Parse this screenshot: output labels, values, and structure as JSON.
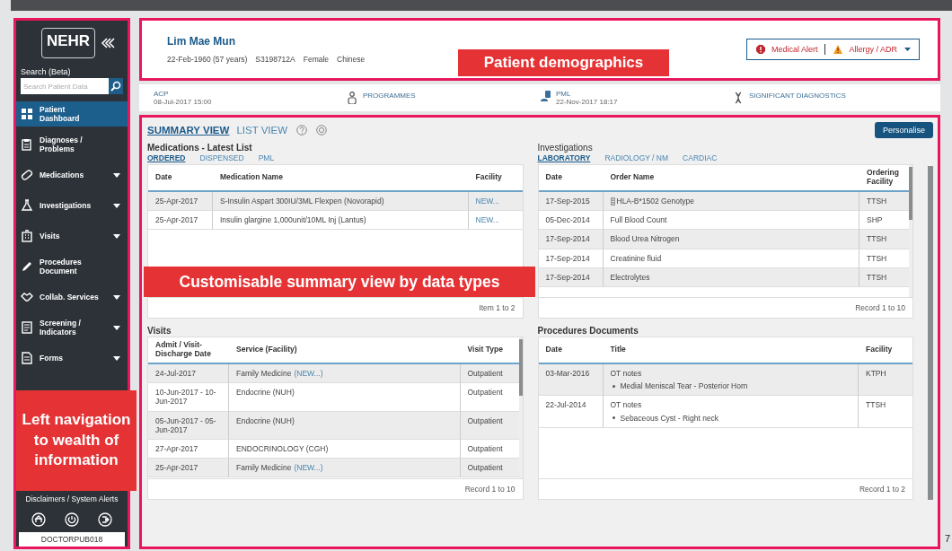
{
  "sidebar": {
    "logo": "NEHR",
    "search_label": "Search (Beta)",
    "search": {
      "placeholder": "Search Patient Data"
    },
    "items": [
      {
        "label": "Patient Dashboard",
        "selected": true,
        "expandable": false
      },
      {
        "label": "Diagnoses / Problems",
        "selected": false,
        "expandable": false
      },
      {
        "label": "Medications",
        "selected": false,
        "expandable": true
      },
      {
        "label": "Investigations",
        "selected": false,
        "expandable": true
      },
      {
        "label": "Visits",
        "selected": false,
        "expandable": true
      },
      {
        "label": "Procedures Document",
        "selected": false,
        "expandable": false
      },
      {
        "label": "Collab. Services",
        "selected": false,
        "expandable": true
      },
      {
        "label": "Screening / Indicators",
        "selected": false,
        "expandable": true
      },
      {
        "label": "Forms",
        "selected": false,
        "expandable": true
      }
    ],
    "disclaimers": "Disclaimers / System Alerts",
    "user": "DOCTORPUB018"
  },
  "patient": {
    "name": "Lim Mae Mun",
    "details": [
      "22-Feb-1960 (57 years)",
      "S3198712A",
      "Female",
      "Chinese"
    ],
    "alerts": [
      "Medical Alert",
      "Allergy / ADR"
    ]
  },
  "info_bar": [
    {
      "label": "ACP",
      "date": "08-Jul-2017 15:00"
    },
    {
      "label": "PROGRAMMES"
    },
    {
      "label": "PML",
      "date": "22-Nov-2017 18:17"
    },
    {
      "label": "SIGNIFICANT DIAGNOSTICS"
    }
  ],
  "summary": {
    "view_tabs": [
      {
        "label": "SUMMARY VIEW",
        "selected": true
      },
      {
        "label": "LIST VIEW",
        "selected": false
      }
    ],
    "personalise": "Personalise",
    "sections": [
      {
        "title": "Medications - Latest List",
        "tabs": [
          {
            "label": "ORDERED",
            "selected": true
          },
          {
            "label": "DISPENSED",
            "selected": false
          },
          {
            "label": "PML",
            "selected": false
          }
        ],
        "table": {
          "columns": [
            "Date",
            "Medication Name",
            "Facility"
          ],
          "scrollbar": false,
          "rows": [
            [
              "25-Apr-2017",
              "S-Insulin Aspart 300IU/3ML Flexpen (Novorapid)",
              {
                "kind": "link",
                "text": "NEW..."
              }
            ],
            [
              "25-Apr-2017",
              "Insulin glargine 1,000unit/10ML Inj (Lantus)",
              {
                "kind": "link",
                "text": "NEW..."
              }
            ]
          ],
          "footer": "Item 1 to 2"
        }
      },
      {
        "title": "Investigations",
        "tabs": [
          {
            "label": "LABORATORY",
            "selected": true
          },
          {
            "label": "RADIOLOGY / NM",
            "selected": false
          },
          {
            "label": "CARDIAC",
            "selected": false
          }
        ],
        "table": {
          "columns": [
            "Date",
            "Order Name",
            "Ordering Facility"
          ],
          "scrollbar": true,
          "rows": [
            [
              "17-Sep-2015",
              {
                "kind": "flagged",
                "text": "HLA-B*1502 Genotype"
              },
              "TTSH"
            ],
            [
              "05-Dec-2014",
              "Full Blood Count",
              "SHP"
            ],
            [
              "17-Sep-2014",
              "Blood Urea Nitrogen",
              "TTSH"
            ],
            [
              "17-Sep-2014",
              "Creatinine fluid",
              "TTSH"
            ],
            [
              "17-Sep-2014",
              "Electrolytes",
              "TTSH"
            ]
          ],
          "footer": "Record 1 to 10"
        }
      },
      {
        "title": "Visits",
        "table": {
          "columns": [
            "Admit / Visit-Discharge Date",
            "Service (Facility)",
            "Visit Type"
          ],
          "scrollbar": true,
          "rows": [
            [
              "24-Jul-2017",
              {
                "kind": "service",
                "service": "Family Medicine",
                "facility": "(NEW...)"
              },
              "Outpatient"
            ],
            [
              "10-Jun-2017 - 10-Jun-2017",
              "Endocrine (NUH)",
              "Outpatient"
            ],
            [
              "05-Jun-2017 - 05-Jun-2017",
              "Endocrine (NUH)",
              "Outpatient"
            ],
            [
              "27-Apr-2017",
              "ENDOCRINOLOGY (CGH)",
              "Outpatient"
            ],
            [
              "25-Apr-2017",
              {
                "kind": "service",
                "service": "Family Medicine",
                "facility": "(NEW...)"
              },
              "Outpatient"
            ]
          ],
          "footer": "Record 1 to 10"
        }
      },
      {
        "title": "Procedures Documents",
        "table": {
          "columns": [
            "Date",
            "Title",
            "Facility"
          ],
          "scrollbar": false,
          "rows": [
            [
              "03-Mar-2016",
              {
                "kind": "note",
                "title": "OT notes",
                "bullets": [
                  "Medial Meniscal Tear - Posterior Horn"
                ]
              },
              "KTPH"
            ],
            [
              "22-Jul-2014",
              {
                "kind": "note",
                "title": "OT notes",
                "bullets": [
                  "Sebaceous Cyst - Right neck"
                ]
              },
              "TTSH"
            ]
          ],
          "footer": "Record 1 to 2"
        }
      }
    ]
  },
  "callouts": [
    "Patient demographics",
    "Customisable summary view by data types",
    "Left navigation to wealth of information"
  ],
  "page_number": "7"
}
